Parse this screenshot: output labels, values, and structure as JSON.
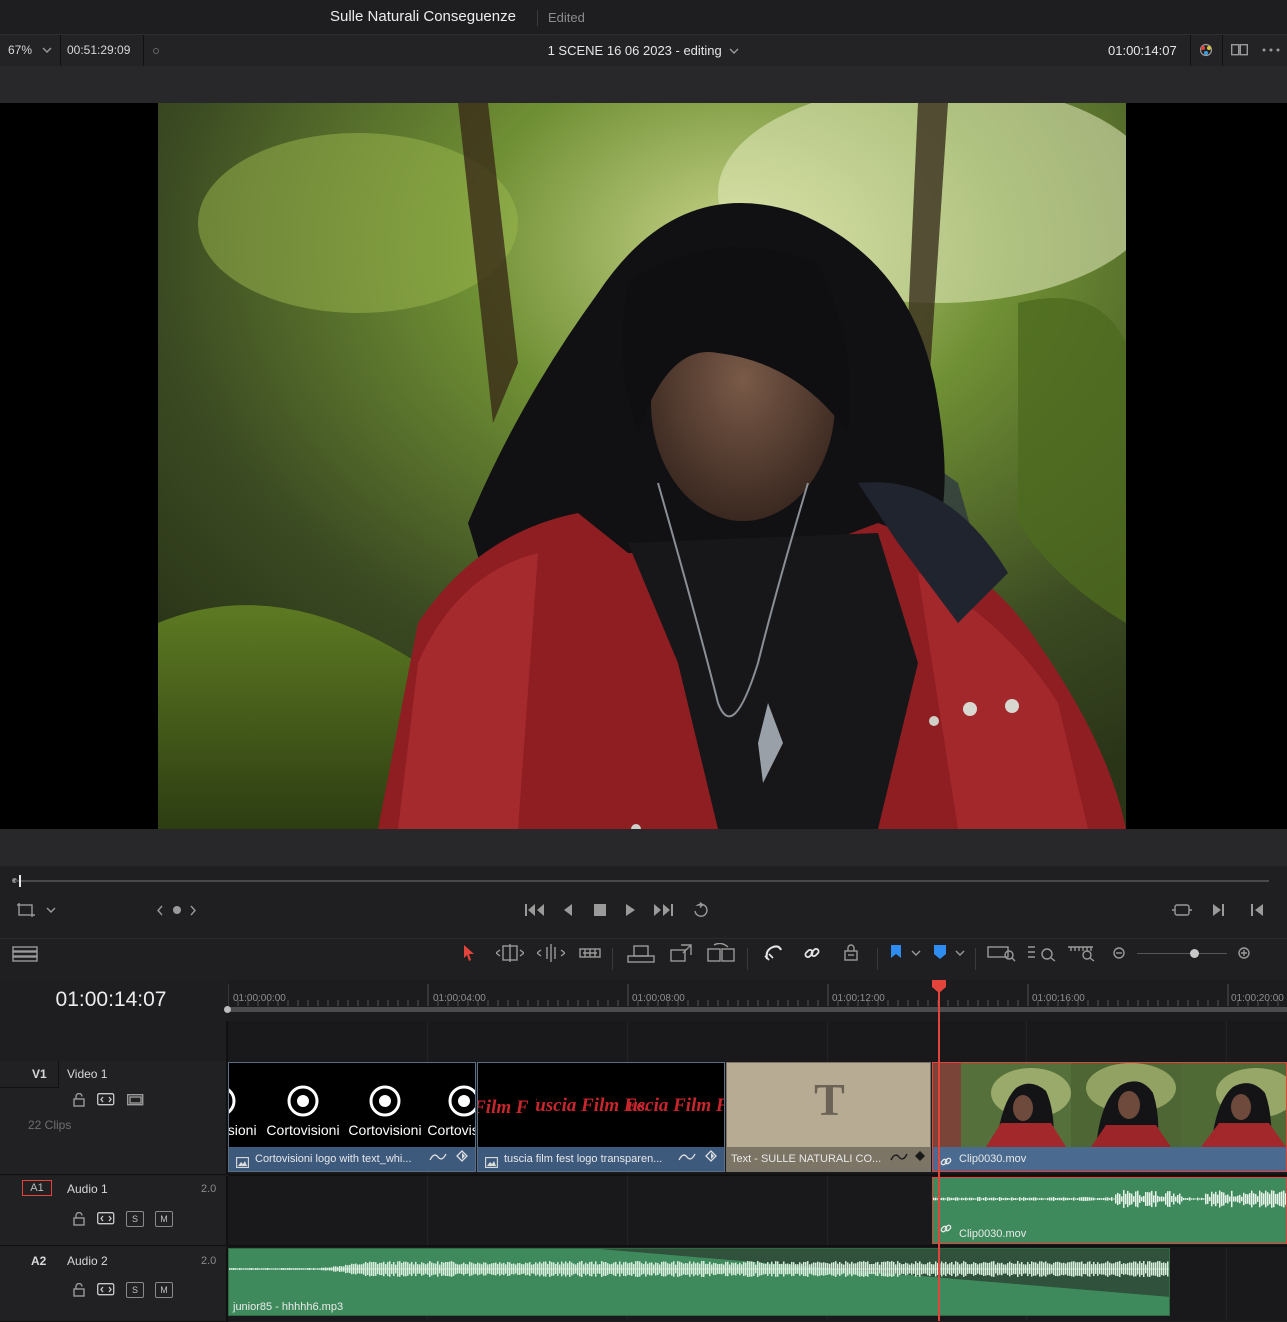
{
  "titlebar": {
    "project_name": "Sulle Naturali Conseguenze",
    "status": "Edited"
  },
  "viewer_header": {
    "zoom": "67%",
    "duration_timecode": "00:51:29:09",
    "timeline_name": "1 SCENE 16 06 2023 - editing",
    "current_timecode": "01:00:14:07"
  },
  "timeline": {
    "timecode": "01:00:14:07",
    "ruler_labels": [
      "01:00:00:00",
      "01:00:04:00",
      "01:00:08:00",
      "01:00:12:00",
      "01:00:16:00",
      "01:00:20:00"
    ],
    "tracks": {
      "v1": {
        "id": "V1",
        "name": "Video 1",
        "clip_count": "22 Clips"
      },
      "a1": {
        "id": "A1",
        "name": "Audio 1",
        "channels": "2.0",
        "solo": "S",
        "mute": "M"
      },
      "a2": {
        "id": "A2",
        "name": "Audio 2",
        "channels": "2.0",
        "solo": "S",
        "mute": "M"
      }
    },
    "clips": {
      "v_clip1": {
        "name": "Cortovisioni logo with text_whi...",
        "thumb_text": "Cortovisioni"
      },
      "v_clip2": {
        "name": "tuscia film fest logo transparen...",
        "thumb_text": "Tuscia Film Fest"
      },
      "v_clip3": {
        "name": "Text - SULLE NATURALI CO...",
        "thumb_text": "T"
      },
      "v_clip4": {
        "name": "Clip0030.mov"
      },
      "a1_clip": {
        "name": "Clip0030.mov"
      },
      "a2_clip": {
        "name": "junior85 - hhhhh6.mp3"
      }
    }
  },
  "colors": {
    "accent_red": "#e2443b",
    "video_clip_label": "#3d5a7d",
    "audio_clip": "#3f8a5d",
    "selected_flag": "#2f8cf0"
  },
  "icons": [
    "crop-icon",
    "prev-marker-icon",
    "next-marker-icon",
    "go-first-icon",
    "step-back-icon",
    "stop-icon",
    "play-icon",
    "go-last-icon",
    "loop-icon",
    "match-frame-icon",
    "pointer-icon",
    "trim-icon",
    "blade-icon",
    "dynamic-trim-icon",
    "insert-icon",
    "overwrite-icon",
    "replace-icon",
    "snap-icon",
    "link-icon",
    "lock-icon",
    "flag-icon",
    "marker-icon",
    "zoom-icon"
  ]
}
